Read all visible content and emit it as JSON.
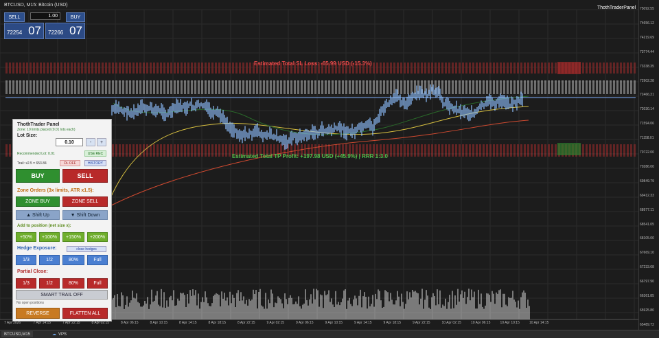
{
  "window": {
    "title": "BTCUSD, M15: Bitcoin (USD)",
    "brand": "ThothTraderPanel"
  },
  "trade": {
    "sell_label": "SELL",
    "buy_label": "BUY",
    "lot_value": "1.00",
    "sell_price_small": "72254",
    "sell_price_big": "07",
    "buy_price_small": "72266",
    "buy_price_big": "07"
  },
  "annotations": {
    "sl_text": "Estimated Total SL Loss: -65.99 USD (-15.3%)",
    "tp_text": "Estimated Total TP Profit: +197.98 USD (+45.9%) | RRR 1:3.0"
  },
  "panel": {
    "title": "ThothTrader Panel",
    "subtitle": "Zone: 10 limits placed (0.01 lots each)",
    "lot_size_label": "Lot Size:",
    "lot_value": "0.10",
    "minus": "-",
    "plus": "+",
    "recommended": "Recommended Lot: 0.01",
    "use_rec": "USE REC",
    "trail": "Trail: x2.5 = 653.84",
    "dl_off": "DL OFF",
    "history": "HISTORY",
    "buy": "BUY",
    "sell": "SELL",
    "zone_header": "Zone Orders (3x limits, ATR x1.5):",
    "zone_buy": "ZONE BUY",
    "zone_sell": "ZONE SELL",
    "shift_up": "▲ Shift Up",
    "shift_down": "▼ Shift Down",
    "add_header": "Add to position (net size x):",
    "add": [
      "+50%",
      "+100%",
      "+150%",
      "+200%"
    ],
    "hedge_header": "Hedge Exposure:",
    "close_hedges": "close hedges",
    "hedge": [
      "1/3",
      "1/2",
      "80%",
      "Full"
    ],
    "partial_header": "Partial Close:",
    "partial": [
      "1/3",
      "1/2",
      "80%",
      "Full"
    ],
    "smart_trail": "SMART TRAIL OFF",
    "no_positions": "No open positions",
    "reverse": "REVERSE",
    "flatten": "FLATTEN ALL"
  },
  "y_axis": [
    "75092.55",
    "74656.12",
    "74219.69",
    "73774.44",
    "73338.35",
    "72902.28",
    "72466.21",
    "72030.14",
    "71594.06",
    "71158.01",
    "70722.00",
    "70286.00",
    "69849.79",
    "69412.33",
    "68977.11",
    "68541.05",
    "68105.00",
    "67669.10",
    "67233.68",
    "66797.90",
    "66361.85",
    "65925.80",
    "65489.72"
  ],
  "x_axis": [
    "7 Apr 2026",
    "7 Apr 14:15",
    "7 Apr 22:15",
    "8 Apr 02:15",
    "8 Apr 06:15",
    "8 Apr 10:15",
    "8 Apr 14:15",
    "8 Apr 18:15",
    "8 Apr 22:15",
    "9 Apr 02:15",
    "9 Apr 06:15",
    "9 Apr 10:15",
    "9 Apr 14:15",
    "9 Apr 18:15",
    "9 Apr 22:15",
    "10 Apr 02:15",
    "10 Apr 06:15",
    "10 Apr 10:15",
    "10 Apr 14:15"
  ],
  "tabs": {
    "symbol": "BTCUSD,M15",
    "vps": "VPS"
  },
  "colors": {
    "bg": "#1c1c1c",
    "sl_zone": "#c43030",
    "tp_zone": "#3ab03a",
    "price_line": "#8fc0ff"
  }
}
